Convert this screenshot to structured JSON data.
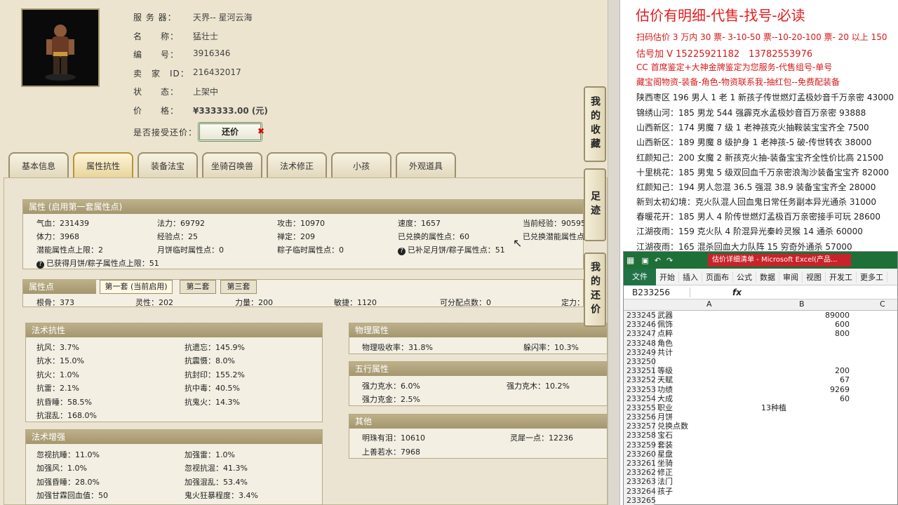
{
  "game": {
    "info": [
      {
        "label": "服 务 器：",
        "value": "天界-- 星河云海"
      },
      {
        "label": "名　　称：",
        "value": "猛壮士"
      },
      {
        "label": "编　　号：",
        "value": "3916346"
      },
      {
        "label": "卖　家　ID：",
        "value": "216432017"
      },
      {
        "label": "状　　态：",
        "value": "上架中"
      },
      {
        "label": "价　　格：",
        "value": "¥333333.00 (元)"
      },
      {
        "label": "是否接受还价：",
        "value": ""
      }
    ],
    "counter_label": "还价",
    "counter_x": "✖",
    "tabs": [
      "基本信息",
      "属性抗性",
      "装备法宝",
      "坐骑召唤兽",
      "法术修正",
      "小孩",
      "外观道具"
    ],
    "side_tabs": [
      "我的收藏",
      "足迹",
      "我的还价"
    ],
    "attr_panel": {
      "title": "属性 (启用第一套属性点)",
      "rows": [
        [
          "气血：231439",
          "法力：69792",
          "攻击：10970",
          "速度：1657",
          "当前经验：90595"
        ],
        [
          "体力：3968",
          "经验点：25",
          "禅定：209",
          "已兑换的属性点：60",
          "已兑换潜能属性点"
        ],
        [
          "潜能属性点上限：2",
          "月饼临时属性点：0",
          "粽子临时属性点：0",
          "已补足月饼/粽子属性点：51",
          ""
        ]
      ],
      "last": "已获得月饼/粽子属性点上限：51"
    },
    "points_panel": {
      "title": "属性点",
      "subtabs": [
        "第一套 (当前启用)",
        "第二套",
        "第三套"
      ],
      "values": [
        "根骨：373",
        "灵性：202",
        "力量：200",
        "敏捷：1120",
        "可分配点数：0",
        "定力："
      ]
    },
    "resist_panel": {
      "title": "法术抗性",
      "left": [
        "抗风：3.7%",
        "抗水：15.0%",
        "抗火：1.0%",
        "抗雷：2.1%",
        "抗昏睡：58.5%",
        "抗混乱：168.0%"
      ],
      "right": [
        "抗遗忘：145.9%",
        "抗震慑：8.0%",
        "抗封印：155.2%",
        "抗中毒：40.5%",
        "抗鬼火：14.3%"
      ]
    },
    "enhance_panel": {
      "title": "法术增强",
      "left": [
        "忽视抗睡：11.0%",
        "加强风：1.0%",
        "加强昏睡：28.0%",
        "加强甘霖回血值：50"
      ],
      "right": [
        "加强雷：1.0%",
        "忽视抗混：41.3%",
        "加强混乱：53.4%",
        "鬼火狂暴程度：3.4%"
      ]
    },
    "phys_panel": {
      "title": "物理属性",
      "items": [
        "物理吸收率：31.8%",
        "躲闪率：10.3%"
      ]
    },
    "five_panel": {
      "title": "五行属性",
      "items": [
        "强力克水：6.0%",
        "强力克木：10.2%",
        "强力克金：2.5%"
      ]
    },
    "other_panel": {
      "title": "其他",
      "items": [
        "明珠有泪：10610",
        "灵犀一点：12236",
        "上善若水：7968"
      ]
    }
  },
  "ad": {
    "title": "估价有明细-代售-找号-必读",
    "lines": [
      {
        "text": "扫码估价 3 万内 30 票- 3-10-50 票--10-20-100 票- 20 以上 150",
        "color": "red"
      },
      {
        "text": "估号加 V 15225921182　13782553976",
        "color": "red"
      },
      {
        "text": "CC 首席鉴定+大神金牌鉴定为您服务-代售组号-单号",
        "color": "red"
      },
      {
        "text": "藏宝阁物资-装备-角色-物资联系我-抽红包--免费配装备",
        "color": "red"
      },
      {
        "text": "陕西枣区 196 男人 1 老 1 新孩子传世燃灯孟极妙音千万亲密 43000",
        "color": "dark"
      },
      {
        "text": "锦绣山河：185 男龙 544 强霹克水孟极妙音百万亲密 93888",
        "color": "dark"
      },
      {
        "text": "山西新区：174 男魔 7 级 1 老神孩克火抽鞍装宝宝齐全 7500",
        "color": "dark"
      },
      {
        "text": "山西新区：189 男魔 8 级护身 1 老神孩-5 破-传世转衣 38000",
        "color": "dark"
      },
      {
        "text": "红颜知己：200 女魔 2 新孩克火抽-装备宝宝齐全性价比高 21500",
        "color": "dark"
      },
      {
        "text": "十里桃花：185 男鬼 5 级双回血千万亲密浪淘沙装备宝宝齐 82000",
        "color": "dark"
      },
      {
        "text": "红颜知己：194 男人忽混 36.5 强混 38.9 装备宝宝齐全 28000",
        "color": "dark"
      },
      {
        "text": "新到太初幻境：克火队混人回血鬼日常任务副本异光通杀 31000",
        "color": "dark"
      },
      {
        "text": "春暖花开：185 男人 4 阶传世燃灯孟极百万亲密接手可玩 28600",
        "color": "dark"
      },
      {
        "text": "江湖夜雨：159 克火队 4 阶混异光秦岭灵猴 14 通杀 60000",
        "color": "dark"
      },
      {
        "text": "江湖夜雨：165 混杀回血大力队阵 15 穷奇外通杀 57000",
        "color": "dark"
      }
    ]
  },
  "excel": {
    "title": "估价详细清单 - Microsoft Excel(产品...",
    "ribbon": [
      "开始",
      "插入",
      "页面布",
      "公式",
      "数据",
      "审阅",
      "视图",
      "开发工",
      "更多工"
    ],
    "file_label": "文件",
    "namebox": "B233256",
    "fx": "fx",
    "cols": [
      "A",
      "B",
      "C"
    ],
    "rows": [
      {
        "n": "233245",
        "a": "武器",
        "b": "89000"
      },
      {
        "n": "233246",
        "a": "佩饰",
        "b": "600"
      },
      {
        "n": "233247",
        "a": "点粹",
        "b": "800"
      },
      {
        "n": "233248",
        "a": "角色",
        "b": ""
      },
      {
        "n": "233249",
        "a": "共计",
        "b": ""
      },
      {
        "n": "233250",
        "a": "",
        "b": ""
      },
      {
        "n": "233251",
        "a": "等级",
        "b": "200"
      },
      {
        "n": "233252",
        "a": "天赋",
        "b": "67"
      },
      {
        "n": "233253",
        "a": "功绩",
        "b": "9269"
      },
      {
        "n": "233254",
        "a": "大成",
        "b": "60"
      },
      {
        "n": "233255",
        "a": "职业",
        "bl": "13种植"
      },
      {
        "n": "233256",
        "a": "月饼",
        "b": ""
      },
      {
        "n": "233257",
        "a": "兑换点数",
        "b": ""
      },
      {
        "n": "233258",
        "a": "宝石",
        "b": ""
      },
      {
        "n": "233259",
        "a": "套装",
        "b": ""
      },
      {
        "n": "233260",
        "a": "星盘",
        "b": ""
      },
      {
        "n": "233261",
        "a": "坐骑",
        "b": ""
      },
      {
        "n": "233262",
        "a": "修正",
        "b": ""
      },
      {
        "n": "233263",
        "a": "法门",
        "b": ""
      },
      {
        "n": "233264",
        "a": "孩子",
        "b": ""
      },
      {
        "n": "233265",
        "a": "",
        "b": ""
      }
    ]
  }
}
